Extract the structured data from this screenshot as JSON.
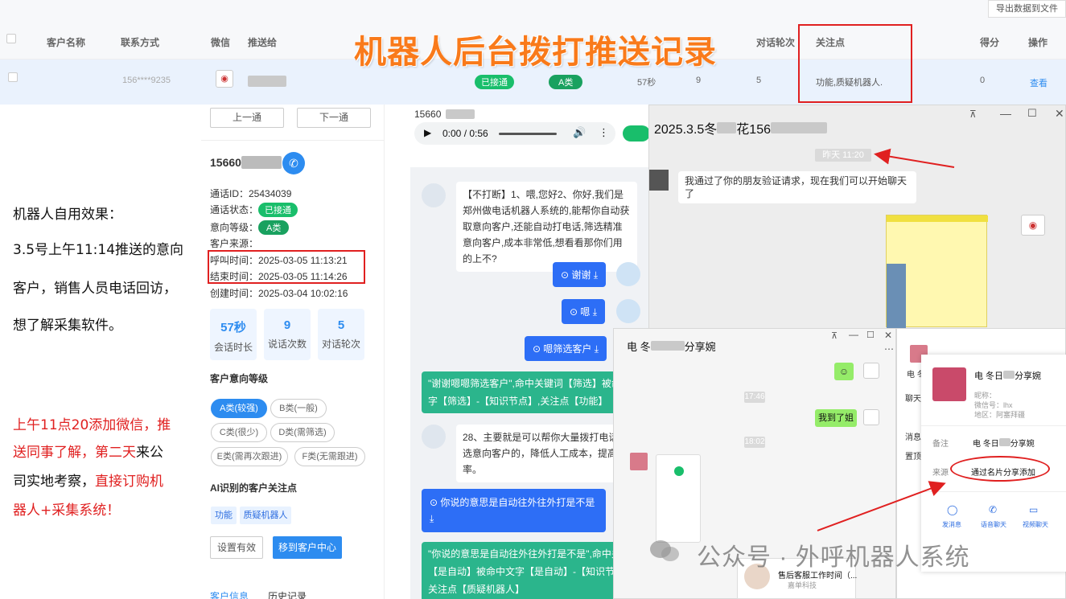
{
  "overlay_title": "机器人后台拨打推送记录",
  "table": {
    "export_label": "导出数据到文件",
    "headers": {
      "customer": "客户名称",
      "contact": "联系方式",
      "wechat": "微信",
      "push_to": "推送给",
      "rounds": "对话轮次",
      "focus": "关注点",
      "score": "得分",
      "action": "操作"
    },
    "row": {
      "phone": "156****9235",
      "status": "已接通",
      "level": "A类",
      "duration": "57秒",
      "count": "9",
      "rounds": "5",
      "focus": "功能,质疑机器人.",
      "score": "0",
      "view": "查看"
    }
  },
  "caption": {
    "line1": "机器人自用效果：",
    "line2": "3.5号上午11:14推送的意向",
    "line3": "客户，销售人员电话回访，",
    "line4": "想了解采集软件。",
    "red1": "上午11点20添加微信，推",
    "red2a": "送同事了解，第二天",
    "red2b": "来公",
    "red3a": "司实地考察，",
    "red3b": "直接订购机",
    "red4": "器人+采集系统！"
  },
  "detail": {
    "prev": "上一通",
    "next": "下一通",
    "phone": "15660",
    "call_id": "通话ID：25434039",
    "status_label": "通话状态：",
    "status": "已接通",
    "level_label": "意向等级：",
    "level": "A类",
    "source": "客户来源：",
    "call_time": "呼叫时间：2025-03-05 11:13:21",
    "end_time": "结束时间：2025-03-05 11:14:26",
    "create_time": "创建时间：2025-03-04 10:02:16",
    "stats": [
      {
        "value": "57秒",
        "label": "会话时长"
      },
      {
        "value": "9",
        "label": "说话次数"
      },
      {
        "value": "5",
        "label": "对话轮次"
      }
    ],
    "intent_title": "客户意向等级",
    "tags": [
      "A类(较强)",
      "B类(一般)",
      "C类(很少)",
      "D类(需筛选)",
      "E类(需再次跟进)",
      "F类(无需跟进)"
    ],
    "ai_title": "AI识别的客户关注点",
    "focus": [
      "功能",
      "质疑机器人"
    ],
    "set_valid": "设置有效",
    "move_center": "移到客户中心",
    "tab_info": "客户信息",
    "tab_history": "历史记录"
  },
  "audio": {
    "phone": "15660",
    "time": "0:00 / 0:56"
  },
  "chat": {
    "bot1": "【不打断】1、喂,您好2、你好,我们是郑州做电话机器人系统的,能帮你自动获取意向客户,还能自动打电话,筛选精准意向客户,成本非常低,想看看那你们用的上不?",
    "user1": "谢谢",
    "user2": "嗯",
    "user3": "嗯筛选客户",
    "hit1": "\"谢谢嗯嗯筛选客户\",命中关键词【筛选】被命中文字【筛选】-【知识节点】,关注点【功能】",
    "bot2": "28、主要就是可以帮你大量拨打电话，筛选意向客户的，降低人工成本，提高效率。",
    "user4": "你说的意思是自动往外往外打是不是",
    "hit2": "\"你说的意思是自动往外往外打是不是\",命中关键词【是自动】被命中文字【是自动】-【知识节点】,关注点【质疑机器人】"
  },
  "wechat1": {
    "title": "2025.3.5冬",
    "title_mid": "花156",
    "time": "昨天 11:20",
    "msg": "我通过了你的朋友验证请求，现在我们可以开始聊天了"
  },
  "wechat2": {
    "title": "电 冬",
    "title_tail": "分享婉",
    "t1": "17:46",
    "msg": "我到了姐",
    "t2": "18:02"
  },
  "profile": {
    "name": "电 冬日",
    "name_tail": "分享婉",
    "nickname": "昵称：",
    "wxid": "微信号：lhx",
    "region": "地区：阿塞拜疆",
    "remark_label": "备注",
    "remark": "电 冬日",
    "remark_tail": "分享婉",
    "source_label": "来源",
    "source": "通过名片分享添加",
    "side1": "消息",
    "side2": "置顶",
    "side3": "聊天",
    "side4": "电 冬",
    "actions": [
      "发消息",
      "语音聊天",
      "视频聊天"
    ]
  },
  "card": {
    "title": "售后客服工作时间（...",
    "company": "嘉单科技"
  },
  "watermark": "公众号 · 外呼机器人系统"
}
